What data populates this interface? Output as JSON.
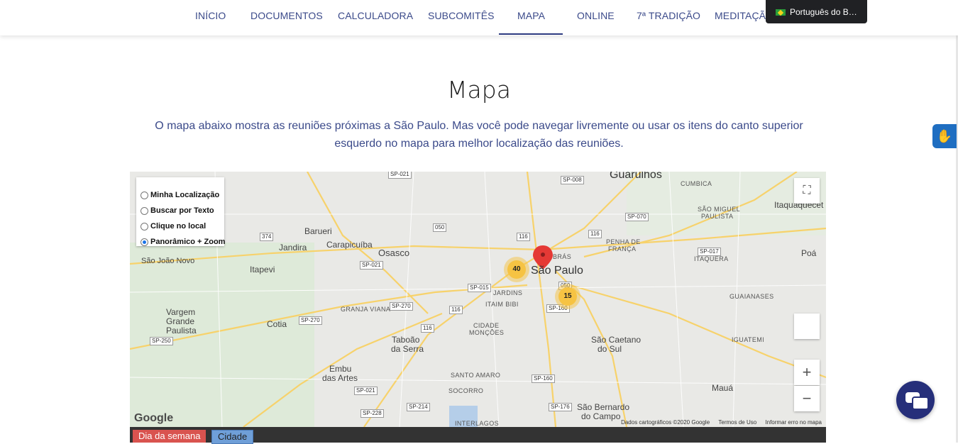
{
  "nav": {
    "items": [
      {
        "label": "INÍCIO"
      },
      {
        "label": "DOCUMENTOS"
      },
      {
        "label": "CALCULADORA"
      },
      {
        "label": "SUBCOMITÊS"
      },
      {
        "label": "MAPA",
        "active": true
      },
      {
        "label": "ONLINE"
      },
      {
        "label": "7ª TRADIÇÃO"
      },
      {
        "label": "MEDITAÇÃO"
      }
    ]
  },
  "language": {
    "label": "Português do B…",
    "flag_icon": "brazil-flag-icon"
  },
  "page": {
    "title": "Mapa",
    "description": "O mapa abaixo mostra as reuniões próximas a São Paulo. Mas você pode navegar livremente ou usar os itens do canto superior esquerdo no mapa para melhor localização das reuniões."
  },
  "map": {
    "modes": [
      {
        "label": "Minha Localização",
        "selected": false
      },
      {
        "label": "Buscar por Texto",
        "selected": false
      },
      {
        "label": "Clique no local",
        "selected": false
      },
      {
        "label": "Panorâmico + Zoom",
        "selected": true
      }
    ],
    "clusters": [
      {
        "count": "40"
      },
      {
        "count": "15"
      }
    ],
    "places": {
      "guarulhos": "Guarulhos",
      "cumbica": "CUMBICA",
      "itaquaquecetuba": "Itaquaquecet",
      "sao_miguel": "SÃO MIGUEL",
      "paulista": "PAULISTA",
      "barueri": "Barueri",
      "jandira": "Jandira",
      "carapicuiba": "Carapicuíba",
      "osasco": "Osasco",
      "bras": "BRÁS",
      "sao_paulo": "São Paulo",
      "penha": "PENHA DE",
      "franca": "FRANÇA",
      "itaquera": "ITAQUERA",
      "poa": "Poá",
      "sao_joao_novo": "São João Novo",
      "itapevi": "Itapevi",
      "jardins": "JARDINS",
      "itaim": "ITAIM BIBI",
      "granja": "GRANJA VIANA",
      "guaianases": "GUAIANASES",
      "vargem": "Vargem",
      "grande": "Grande",
      "paulista2": "Paulista",
      "cotia": "Cotia",
      "cidade": "CIDADE",
      "moncoes": "MONÇÕES",
      "taboao": "Taboão",
      "da_serra": "da Serra",
      "sao_caetano": "São Caetano",
      "do_sul": "do Sul",
      "iguatemi": "IGUATEMI",
      "embu": "Embu",
      "das_artes": "das Artes",
      "santo_amaro": "SANTO AMARO",
      "maua": "Mauá",
      "socorro": "SOCORRO",
      "sao_bernardo": "São Bernardo",
      "do_campo": "do Campo",
      "interlagos": "INTERLAGOS"
    },
    "shields": [
      "SP-021",
      "SP-008",
      "SP-070",
      "050",
      "116",
      "116",
      "374",
      "SP-021",
      "SP-017",
      "SP-015",
      "SP-270",
      "116",
      "SP-160",
      "SP-270",
      "116",
      "SP-250",
      "SP-160",
      "SP-021",
      "SP-214",
      "SP-176",
      "SP-228",
      "050"
    ],
    "attribution": {
      "data": "Dados cartográficos ©2020 Google",
      "terms": "Termos de Uso",
      "report": "Informar erro no mapa",
      "logo": "Google"
    },
    "controls": {
      "zoom_in": "+",
      "zoom_out": "−"
    }
  },
  "filters": {
    "day_label": "Dia da semana",
    "city_label": "Cidade",
    "day_color": "#d9534f",
    "city_color": "#6f9fd8"
  },
  "colors": {
    "accent": "#3b4a8a",
    "chat": "#262f7a"
  }
}
